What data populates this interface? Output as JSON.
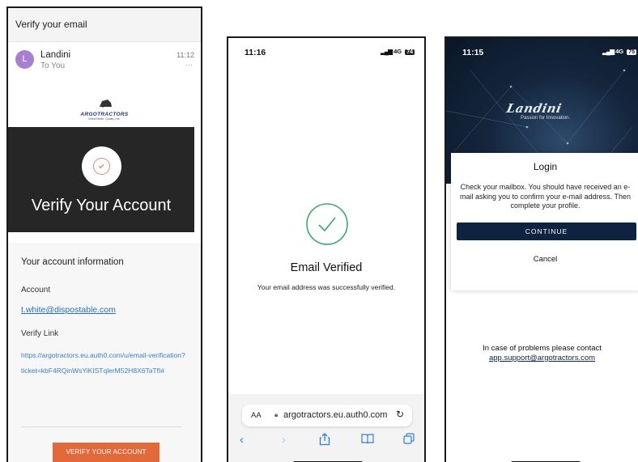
{
  "email_panel": {
    "subject": "Verify your email",
    "sender_initial": "L",
    "sender_name": "Landini",
    "recipient": "To You",
    "time": "11:12",
    "more": "···",
    "logo_brand": "ARGOTRACTORS",
    "logo_tag": "World Made. Quality Life.",
    "banner_title": "Verify Your Account",
    "section_title": "Your account information",
    "account_label": "Account",
    "account_email": "t.white@dispostable.com",
    "verify_label": "Verify Link",
    "verify_url": "https://argotractors.eu.auth0.com/u/email-verification?ticket=kbF4RQinWsYiKISTqlerM52H8X6TaTfI#",
    "cta_label": "VERIFY YOUR ACCOUNT",
    "colors": {
      "banner": "#262626",
      "cta": "#e2693a",
      "link": "#2a6fb0"
    }
  },
  "verified_panel": {
    "time": "11:16",
    "network": "4G",
    "battery": "74",
    "title": "Email Verified",
    "message": "Your email address was successfully verified.",
    "text_size_label": "AA",
    "url": "argotractors.eu.auth0.com",
    "icons": [
      "back-icon",
      "forward-icon",
      "share-icon",
      "bookmarks-icon",
      "tabs-icon"
    ],
    "colors": {
      "check": "#3aa76d",
      "toolbar_icons": "#2b7de9"
    }
  },
  "login_panel": {
    "time": "11:15",
    "network": "4G",
    "battery": "75",
    "brand": "Landini",
    "brand_tagline": "Passion for Innovation.",
    "dialog_title": "Login",
    "dialog_message": "Check your mailbox. You should have received an e-mail asking you to confirm your e-mail address. Then complete your profile.",
    "continue_label": "CONTINUE",
    "cancel_label": "Cancel",
    "help_text": "In case of problems please contact",
    "help_email": "app.support@argotractors.com",
    "colors": {
      "primary": "#0d2340"
    }
  }
}
